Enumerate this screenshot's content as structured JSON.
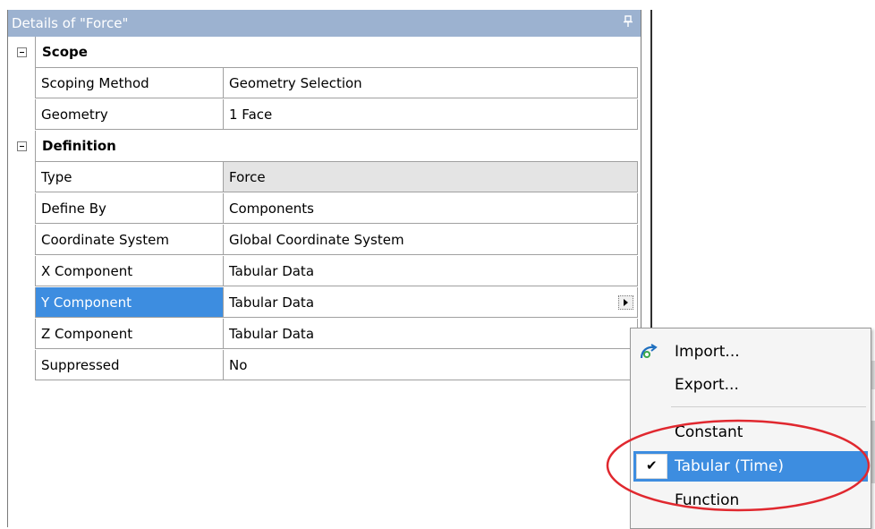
{
  "panel": {
    "title": "Details of \"Force\"",
    "pin_glyph": "ᵽ"
  },
  "groups": [
    {
      "label": "Scope",
      "rows": [
        {
          "name": "Scoping Method",
          "value": "Geometry Selection"
        },
        {
          "name": "Geometry",
          "value": "1 Face"
        }
      ]
    },
    {
      "label": "Definition",
      "rows": [
        {
          "name": "Type",
          "value": "Force"
        },
        {
          "name": "Define By",
          "value": "Components"
        },
        {
          "name": "Coordinate System",
          "value": "Global Coordinate System"
        },
        {
          "name": "X Component",
          "value": "Tabular Data"
        },
        {
          "name": "Y Component",
          "value": "Tabular Data"
        },
        {
          "name": "Z Component",
          "value": "Tabular Data"
        },
        {
          "name": "Suppressed",
          "value": "No"
        }
      ]
    }
  ],
  "selected_row": "Y Component",
  "context_menu": {
    "items": [
      {
        "label": "Import...",
        "icon": "import-icon"
      },
      {
        "label": "Export..."
      },
      {
        "label": "Constant"
      },
      {
        "label": "Tabular (Time)",
        "checked": true,
        "highlighted": true
      },
      {
        "label": "Function"
      }
    ]
  },
  "colors": {
    "titlebar": "#9cb2d0",
    "selection": "#3d8de0",
    "annotation": "#e0282f"
  }
}
